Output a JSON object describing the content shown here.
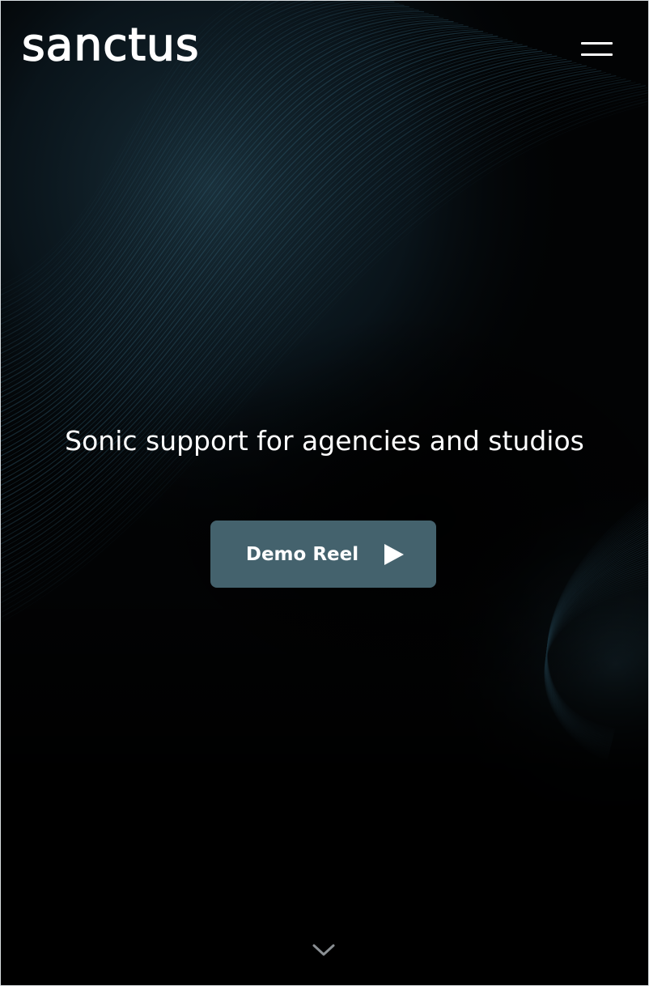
{
  "header": {
    "logo_text": "sanctus",
    "menu_icon": "hamburger-menu-icon"
  },
  "hero": {
    "tagline": "Sonic support for agencies and studios",
    "demo_button": {
      "label": "Demo Reel",
      "icon": "play-icon"
    },
    "scroll_icon": "chevron-down-icon"
  },
  "colors": {
    "background": "#000000",
    "accent_button": "#44626d",
    "wave_teal": "#2f5a6e",
    "text": "#ffffff",
    "chevron": "#8a8f93"
  }
}
